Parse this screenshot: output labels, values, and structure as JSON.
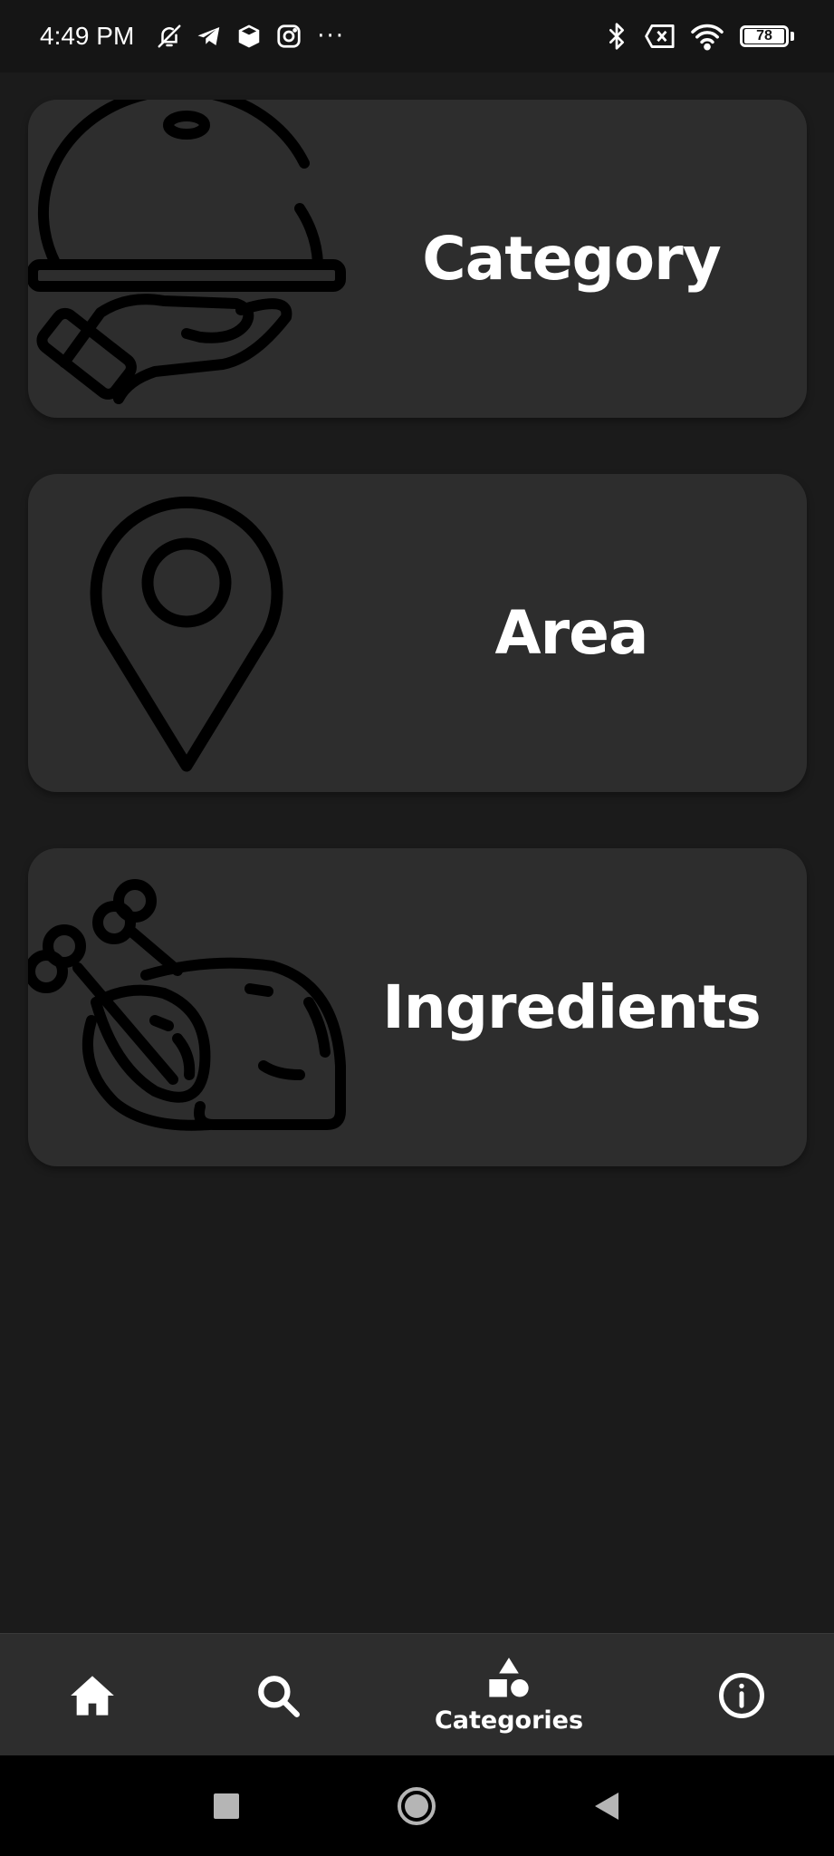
{
  "status_bar": {
    "time": "4:49 PM",
    "battery": "78",
    "more": "···"
  },
  "cards": [
    {
      "label": "Category",
      "icon": "serving-cloche-icon"
    },
    {
      "label": "Area",
      "icon": "location-pin-icon"
    },
    {
      "label": "Ingredients",
      "icon": "roast-chicken-icon"
    }
  ],
  "bottom_nav": {
    "items": [
      {
        "icon": "home-icon",
        "label": ""
      },
      {
        "icon": "search-icon",
        "label": ""
      },
      {
        "icon": "categories-icon",
        "label": "Categories",
        "active": true
      },
      {
        "icon": "info-icon",
        "label": ""
      }
    ]
  },
  "colors": {
    "background": "#1b1b1b",
    "card": "#2d2d2d",
    "status_bar": "#151515",
    "nav_bar": "#2d2d2d",
    "system_nav": "#000000",
    "text": "#ffffff",
    "icon_stroke": "#000000"
  }
}
